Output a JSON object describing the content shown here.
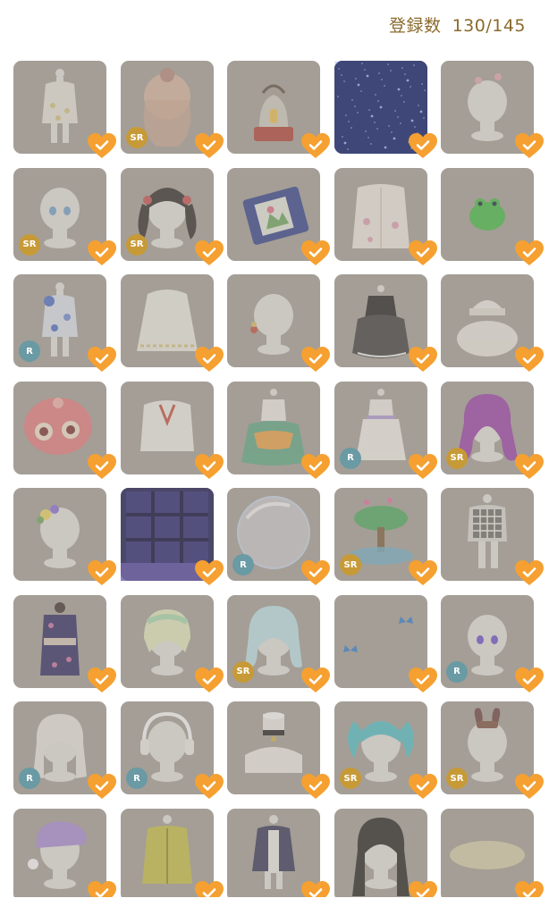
{
  "header": {
    "label": "登録数",
    "current": "130",
    "total": "/145"
  },
  "colors": {
    "tile": "#a49e96",
    "heart": "#f5a030",
    "sr_badge": "#c79a38",
    "r_badge": "#6a9aa4",
    "count_text": "#8a6a2c"
  },
  "rows": [
    {
      "items": [
        {
          "name": "outfit-white-gold-dress",
          "badge": ""
        },
        {
          "name": "hair-peach-sr",
          "badge": "SR"
        },
        {
          "name": "red-lantern",
          "badge": ""
        },
        {
          "name": "starry-night-background",
          "badge": ""
        },
        {
          "name": "white-head-pink-flowers",
          "badge": ""
        }
      ]
    },
    {
      "items": [
        {
          "name": "blue-eyes-face",
          "badge": "SR"
        },
        {
          "name": "black-twin-tails-hair",
          "badge": "SR"
        },
        {
          "name": "blue-photo-book",
          "badge": ""
        },
        {
          "name": "floral-cardigan",
          "badge": ""
        },
        {
          "name": "green-frog-item",
          "badge": ""
        }
      ]
    },
    {
      "items": [
        {
          "name": "blue-floral-outfit",
          "badge": "R"
        },
        {
          "name": "white-cape",
          "badge": ""
        },
        {
          "name": "white-head-red-ornament",
          "badge": ""
        },
        {
          "name": "black-frilly-dress",
          "badge": ""
        },
        {
          "name": "white-knit-hat",
          "badge": ""
        }
      ]
    },
    {
      "items": [
        {
          "name": "pink-octopus",
          "badge": ""
        },
        {
          "name": "white-sailor-blouse",
          "badge": ""
        },
        {
          "name": "green-orange-dress",
          "badge": ""
        },
        {
          "name": "white-lavender-dress",
          "badge": "R"
        },
        {
          "name": "purple-long-hair",
          "badge": "SR"
        }
      ]
    },
    {
      "items": [
        {
          "name": "flower-crown",
          "badge": ""
        },
        {
          "name": "window-background",
          "badge": ""
        },
        {
          "name": "soap-bubble",
          "badge": "R"
        },
        {
          "name": "bonsai-tree-pond",
          "badge": "SR"
        },
        {
          "name": "plaid-vest-outfit",
          "badge": ""
        }
      ]
    },
    {
      "items": [
        {
          "name": "navy-kimono",
          "badge": ""
        },
        {
          "name": "rainbow-short-hair",
          "badge": ""
        },
        {
          "name": "light-blue-hair",
          "badge": "SR"
        },
        {
          "name": "blue-butterflies",
          "badge": ""
        },
        {
          "name": "purple-eyes-face",
          "badge": "R"
        }
      ]
    },
    {
      "items": [
        {
          "name": "white-braided-hair",
          "badge": "R"
        },
        {
          "name": "headphones",
          "badge": "R"
        },
        {
          "name": "black-choker",
          "badge": ""
        },
        {
          "name": "teal-twin-hair",
          "badge": "SR"
        },
        {
          "name": "bunny-ear-ribbon",
          "badge": "SR"
        }
      ]
    },
    {
      "items": [
        {
          "name": "lavender-night-cap",
          "badge": ""
        },
        {
          "name": "yellow-coat",
          "badge": ""
        },
        {
          "name": "navy-cape-dress",
          "badge": ""
        },
        {
          "name": "black-long-hair",
          "badge": ""
        },
        {
          "name": "oval-rug",
          "badge": ""
        }
      ]
    }
  ]
}
